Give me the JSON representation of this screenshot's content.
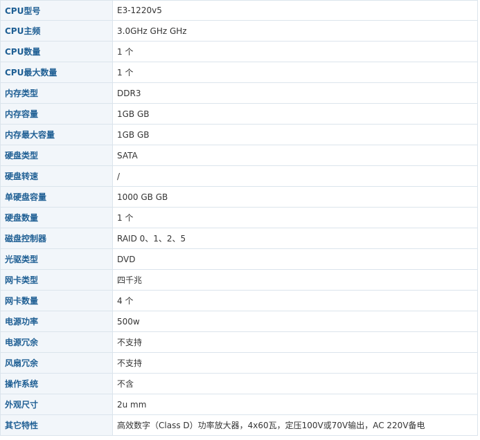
{
  "specs": [
    {
      "label": "CPU型号",
      "value": "E3-1220v5"
    },
    {
      "label": "CPU主频",
      "value": "3.0GHz GHz  GHz"
    },
    {
      "label": "CPU数量",
      "value": "1  个"
    },
    {
      "label": "CPU最大数量",
      "value": "1  个"
    },
    {
      "label": "内存类型",
      "value": "DDR3"
    },
    {
      "label": "内存容量",
      "value": "1GB  GB"
    },
    {
      "label": "内存最大容量",
      "value": "1GB  GB"
    },
    {
      "label": "硬盘类型",
      "value": "SATA"
    },
    {
      "label": "硬盘转速",
      "value": "/"
    },
    {
      "label": "单硬盘容量",
      "value": "1000 GB  GB"
    },
    {
      "label": "硬盘数量",
      "value": "1  个"
    },
    {
      "label": "磁盘控制器",
      "value": "RAID 0、1、2、5"
    },
    {
      "label": "光驱类型",
      "value": "DVD"
    },
    {
      "label": "网卡类型",
      "value": "四千兆"
    },
    {
      "label": "网卡数量",
      "value": "4  个"
    },
    {
      "label": "电源功率",
      "value": "500w"
    },
    {
      "label": "电源冗余",
      "value": "不支持"
    },
    {
      "label": "风扇冗余",
      "value": "不支持"
    },
    {
      "label": "操作系统",
      "value": "不含"
    },
    {
      "label": "外观尺寸",
      "value": "2u  mm"
    },
    {
      "label": "其它特性",
      "value": "高效数字（Class D）功率放大器，4x60瓦，定压100V或70V输出，AC 220V备电"
    }
  ],
  "colors": {
    "label_text": "#1f5f94",
    "label_bg": "#f2f6fa",
    "border": "#dbe4ec",
    "value_text": "#333333"
  }
}
